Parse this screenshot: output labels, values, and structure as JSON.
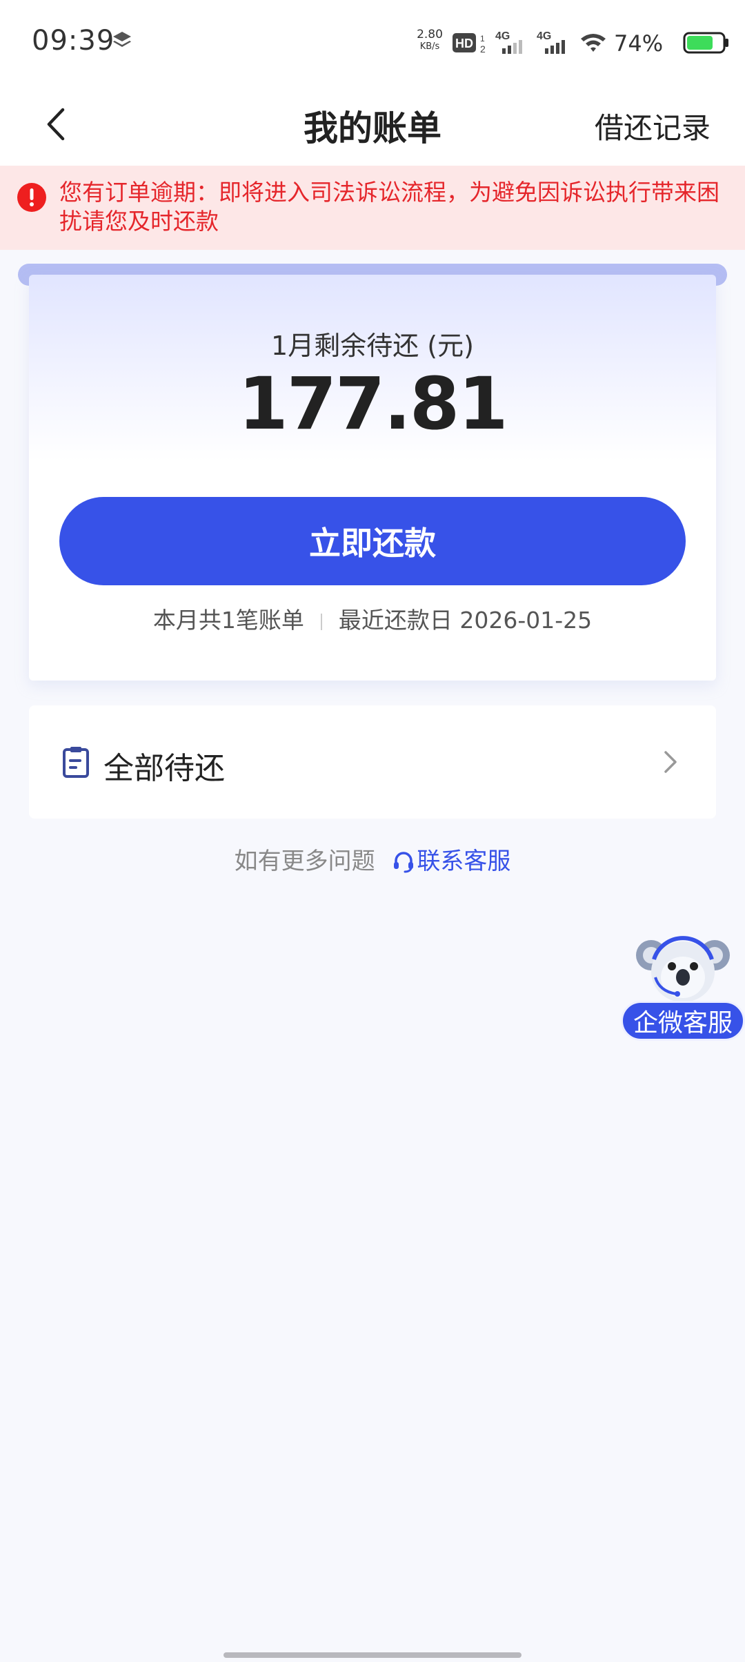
{
  "status_bar": {
    "time": "09:39",
    "net_speed": "2.80",
    "net_unit": "KB/s",
    "signal_1": "4G",
    "signal_2": "4G",
    "battery_percent": "74%",
    "battery_level": 0.74,
    "battery_color": "#3ddc5a",
    "hd_label": "HD"
  },
  "header": {
    "title": "我的账单",
    "records_link": "借还记录"
  },
  "warning": {
    "text": "您有订单逾期：即将进入司法诉讼流程，为避免因诉讼执行带来困扰请您及时还款",
    "color": "#e5262b"
  },
  "bill_card": {
    "label": "1月剩余待还 (元)",
    "amount": "177.81",
    "repay_button": "立即还款",
    "bill_count": "本月共1笔账单",
    "due_date": "最近还款日 2026-01-25",
    "accent": "#3752e8"
  },
  "all_pending": {
    "label": "全部待还"
  },
  "help": {
    "prompt": "如有更多问题",
    "contact": "联系客服"
  },
  "float_service": {
    "label": "企微客服"
  }
}
